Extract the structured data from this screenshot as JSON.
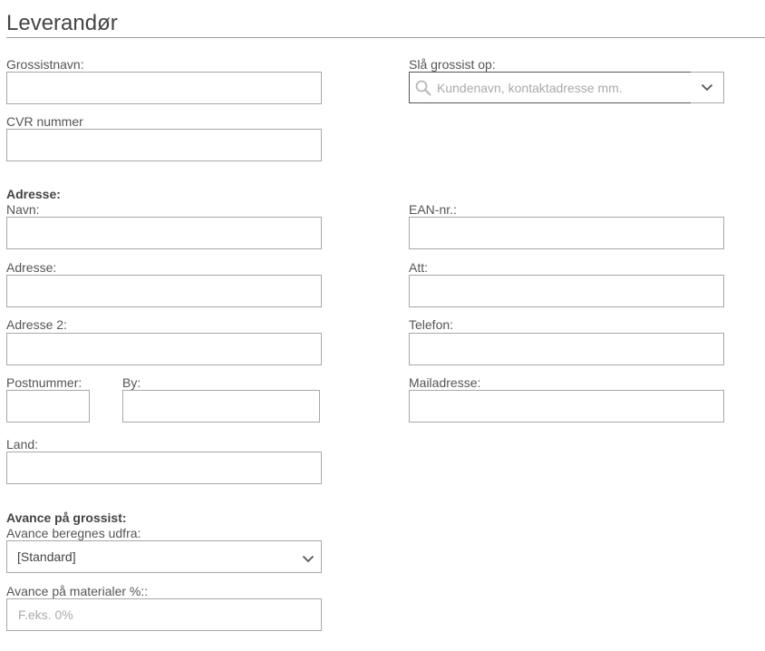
{
  "header": {
    "title": "Leverandør"
  },
  "wholesaler": {
    "name_label": "Grossistnavn:",
    "name_value": "",
    "lookup_label": "Slå grossist op:",
    "lookup_placeholder": "Kundenavn, kontaktadresse mm.",
    "cvr_label": "CVR nummer",
    "cvr_value": ""
  },
  "address": {
    "heading": "Adresse:",
    "name_label": "Navn:",
    "ean_label": "EAN-nr.:",
    "address_label": "Adresse:",
    "att_label": "Att:",
    "address2_label": "Adresse 2:",
    "phone_label": "Telefon:",
    "postal_label": "Postnummer:",
    "city_label": "By:",
    "email_label": "Mailadresse:",
    "country_label": "Land:"
  },
  "markup": {
    "heading": "Avance på grossist:",
    "calc_label": "Avance beregnes udfra:",
    "calc_selected": "[Standard]",
    "materials_label": "Avance på materialer %::",
    "materials_placeholder": "F.eks. 0%"
  },
  "icons": {
    "lookup": "search-icon",
    "lookup_toggle": "chevron-down-icon",
    "select_toggle": "chevron-down-icon"
  }
}
